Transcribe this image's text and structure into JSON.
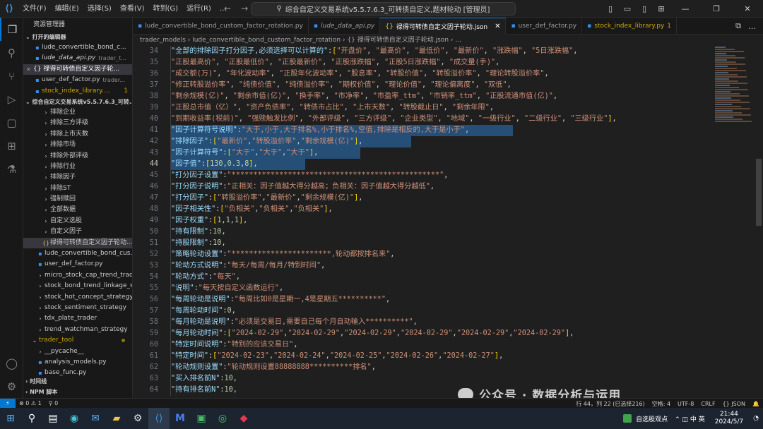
{
  "titlebar": {
    "menu": [
      "文件(F)",
      "编辑(E)",
      "选择(S)",
      "查看(V)",
      "转到(G)",
      "运行(R)",
      "…"
    ],
    "search_text": "综合自定义交易系统v5.5.7.6.3_可转债自定义,题材轮动 [管理员]",
    "nav_back": "←",
    "nav_forward": "→",
    "search_icon": "⚲"
  },
  "sidebar": {
    "title": "资源管理器",
    "open_editors_label": "打开的编辑器",
    "open_editors": [
      {
        "name": "lude_convertible_bond_c...",
        "icon": "py",
        "desc": "",
        "badge": ""
      },
      {
        "name": "lude_data_api.py",
        "icon": "py",
        "desc": "trader_t...",
        "badge": "",
        "italic": true
      },
      {
        "name": "{} 禄得可转债自定义因子轮...",
        "icon": "json",
        "desc": "",
        "badge": "",
        "selected": true,
        "close": "✕"
      },
      {
        "name": "user_def_factor.py",
        "icon": "py",
        "desc": "trader...",
        "badge": ""
      },
      {
        "name": "stock_index_library....",
        "icon": "py",
        "desc": "",
        "badge": "1",
        "yellow": true
      }
    ],
    "project_label": "综合自定义交易系统v5.5.7.6.3_可转...",
    "tree": [
      {
        "name": "排除企业",
        "indent": 2,
        "type": "folder"
      },
      {
        "name": "排除三方评级",
        "indent": 2,
        "type": "folder"
      },
      {
        "name": "排除上市天数",
        "indent": 2,
        "type": "folder"
      },
      {
        "name": "排除市场",
        "indent": 2,
        "type": "folder"
      },
      {
        "name": "排除外部评级",
        "indent": 2,
        "type": "folder"
      },
      {
        "name": "排除行业",
        "indent": 2,
        "type": "folder"
      },
      {
        "name": "排除因子",
        "indent": 2,
        "type": "folder"
      },
      {
        "name": "排除ST",
        "indent": 2,
        "type": "folder"
      },
      {
        "name": "强制赎回",
        "indent": 2,
        "type": "folder"
      },
      {
        "name": "全部数据",
        "indent": 2,
        "type": "folder"
      },
      {
        "name": "自定义选股",
        "indent": 2,
        "type": "folder"
      },
      {
        "name": "自定义因子",
        "indent": 2,
        "type": "folder"
      },
      {
        "name": "禄得可转债自定义因子轮动...",
        "indent": 2,
        "type": "json",
        "selected": true
      },
      {
        "name": "lude_convertible_bond_cus...",
        "indent": 1,
        "type": "py"
      },
      {
        "name": "user_def_factor.py",
        "indent": 1,
        "type": "py"
      },
      {
        "name": "micro_stock_cap_trend_tradi...",
        "indent": 1,
        "type": "folder"
      },
      {
        "name": "stock_bond_trend_linkage_st...",
        "indent": 1,
        "type": "folder"
      },
      {
        "name": "stock_hot_concept_strategy",
        "indent": 1,
        "type": "folder"
      },
      {
        "name": "stock_sentiment_strategy",
        "indent": 1,
        "type": "folder"
      },
      {
        "name": "tdx_plate_trader",
        "indent": 1,
        "type": "folder"
      },
      {
        "name": "trend_watchman_strategy",
        "indent": 1,
        "type": "folder"
      },
      {
        "name": "trader_tool",
        "indent": 0,
        "type": "folder-open",
        "yellow": true,
        "dot": true
      },
      {
        "name": "__pycache__",
        "indent": 1,
        "type": "folder"
      },
      {
        "name": "analysis_models.py",
        "indent": 1,
        "type": "py"
      },
      {
        "name": "base_func.py",
        "indent": 1,
        "type": "py"
      }
    ],
    "timeline_label": "时间线",
    "npm_label": "NPM 脚本"
  },
  "tabs": [
    {
      "label": "lude_convertible_bond_custom_factor_rotation.py",
      "icon": "py",
      "italic": false
    },
    {
      "label": "lude_data_api.py",
      "icon": "py",
      "italic": true
    },
    {
      "label": "禄得可转债自定义因子轮动.json",
      "icon": "json",
      "active": true,
      "close": "✕"
    },
    {
      "label": "user_def_factor.py",
      "icon": "py"
    },
    {
      "label": "stock_index_library.py",
      "icon": "py",
      "badge": "1",
      "yellow": true
    }
  ],
  "tab_actions": [
    "⧉",
    "…"
  ],
  "breadcrumb": "trader_models › lude_convertible_bond_custom_factor_rotation › {} 禄得可转债自定义因子轮动.json › …",
  "code": [
    {
      "n": 34,
      "t": "\"全部的排除因子打分因子,必须选择可以计算的\":[\"开盘价\", \"最高价\", \"最低价\", \"最新价\", \"涨跌幅\", \"5日涨跌幅\","
    },
    {
      "n": 35,
      "t": "\"正股最高价\", \"正股最低价\", \"正股最新价\", \"正股涨跌幅\", \"正股5日涨跌幅\", \"成交量(手)\","
    },
    {
      "n": 36,
      "t": "\"成交额(万)\", \"年化波动率\", \"正股年化波动率\", \"股息率\", \"转股价值\", \"转股溢价率\", \"理论转股溢价率\","
    },
    {
      "n": 37,
      "t": "\"修正转股溢价率\", \"纯债价值\", \"纯债溢价率\", \"期权价值\", \"理论价值\", \"理论偏离度\", \"双低\","
    },
    {
      "n": 38,
      "t": "\"剩余规模(亿)\", \"剩余市值(亿)\", \"换手率\", \"市净率\", \"市盈率_ttm\", \"市销率_ttm\", \"正股流通市值(亿)\","
    },
    {
      "n": 39,
      "t": "\"正股总市值（亿）\", \"资产负债率\", \"转债市占比\", \"上市天数\", \"转股截止日\", \"剩余年限\","
    },
    {
      "n": 40,
      "t": "\"到期收益率(税前)\", \"强赎触发比例\", \"外部评级\", \"三方评级\", \"企业类型\", \"地域\", \"一级行业\", \"二级行业\", \"三级行业\"],"
    },
    {
      "n": 41,
      "t": "\"因子计算符号说明\":\"大于,小于,大于排名%,小于排名%,空值,排除是相反的,大于是小于\",",
      "sel": true
    },
    {
      "n": 42,
      "t": "\"排除因子\":[\"最新价\",\"转股溢价率\",\"剩余规模(亿)\"],",
      "sel": true
    },
    {
      "n": 43,
      "t": "\"因子计算符号\":[\"大于\",\"大于\",\"大于\"],",
      "sel": true
    },
    {
      "n": 44,
      "t": "\"因子值\":[130,0.3,8],",
      "sel": true,
      "cur": true
    },
    {
      "n": 45,
      "t": "\"打分因子设置\":\"************************************************\","
    },
    {
      "n": 46,
      "t": "\"打分因子说明\":\"正相关：因子值越大得分越高；负相关：因子值越大得分越低\","
    },
    {
      "n": 47,
      "t": "\"打分因子\":[\"转股溢价率\",\"最新价\",\"剩余规模(亿)\"],"
    },
    {
      "n": 48,
      "t": "\"因子相关性\":[\"负相关\",\"负相关\",\"负相关\"],"
    },
    {
      "n": 49,
      "t": "\"因子权重\":[1,1,1],"
    },
    {
      "n": 50,
      "t": "\"持有限制\":10,"
    },
    {
      "n": 51,
      "t": "\"持股限制\":10,"
    },
    {
      "n": 52,
      "t": "\"策略轮动设置\":\"***********************,轮动都按排名来\","
    },
    {
      "n": 53,
      "t": "\"轮动方式说明\":\"每天/每周/每月/特别时间\","
    },
    {
      "n": 54,
      "t": "\"轮动方式\":\"每天\","
    },
    {
      "n": 55,
      "t": "\"说明\":\"每天按自定义函数运行\","
    },
    {
      "n": 56,
      "t": "\"每周轮动是说明\":\"每周比如0是星期一,4是星期五**********\","
    },
    {
      "n": 57,
      "t": "\"每周轮动时间\":0,"
    },
    {
      "n": 58,
      "t": "\"每月轮动是说明\":\"必须是交易日,需要自己每个月自动输入**********\","
    },
    {
      "n": 59,
      "t": "\"每月轮动时间\":[\"2024-02-29\",\"2024-02-29\",\"2024-02-29\",\"2024-02-29\",\"2024-02-29\",\"2024-02-29\"],"
    },
    {
      "n": 60,
      "t": "\"特定时间说明\":\"特别的应该交易日\","
    },
    {
      "n": 61,
      "t": "\"特定时间\":[\"2024-02-23\",\"2024-02-24\",\"2024-02-25\",\"2024-02-26\",\"2024-02-27\"],"
    },
    {
      "n": 62,
      "t": "\"轮动规则设置\":\"轮动规则设置88888888**********排名\","
    },
    {
      "n": 63,
      "t": "\"买入排名前N\":10,"
    },
    {
      "n": 64,
      "t": "\"持有排名前N\":10,"
    }
  ],
  "status": {
    "remote": "⚡",
    "problems": "⊗ 0 ⚠ 1",
    "ports": "⚲ 0",
    "position": "行 44，列 22 (已选择216)",
    "spaces": "空格: 4",
    "encoding": "UTF-8",
    "eol": "CRLF",
    "language": "{} JSON"
  },
  "watermark": "公众号 · 数据分析与运用",
  "taskbar": {
    "news": "自选股观点",
    "tray": "⌃ ◫ 中 英",
    "time": "21:44",
    "date": "2024/5/7"
  },
  "colors": {
    "accent": "#0078d4",
    "selection": "#264f78",
    "string": "#ce9178",
    "number": "#b5cea8"
  }
}
